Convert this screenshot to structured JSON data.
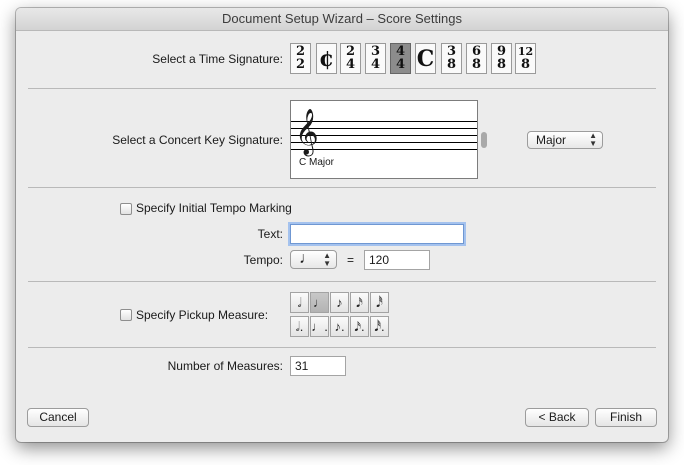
{
  "window": {
    "title": "Document Setup Wizard – Score Settings"
  },
  "time_signature": {
    "label": "Select a Time Signature:",
    "options": [
      {
        "top": "2",
        "bottom": "2"
      },
      {
        "symbol": "¢"
      },
      {
        "top": "2",
        "bottom": "4"
      },
      {
        "top": "3",
        "bottom": "4"
      },
      {
        "top": "4",
        "bottom": "4"
      },
      {
        "symbol": "C"
      },
      {
        "top": "3",
        "bottom": "8"
      },
      {
        "top": "6",
        "bottom": "8"
      },
      {
        "top": "9",
        "bottom": "8"
      },
      {
        "top": "12",
        "bottom": "8"
      }
    ]
  },
  "key_signature": {
    "label": "Select a Concert Key Signature:",
    "key_name": "C Major",
    "clef": "𝄞",
    "mode": "Major"
  },
  "tempo": {
    "checkbox_label": "Specify Initial Tempo Marking",
    "text_label": "Text:",
    "text_value": "",
    "tempo_label": "Tempo:",
    "note_symbol": "♩",
    "equals": "=",
    "value": "120"
  },
  "pickup": {
    "checkbox_label": "Specify Pickup Measure:",
    "notes_row1": [
      "𝅗𝅥",
      "♩",
      "♪",
      "𝅘𝅥𝅯",
      "𝅘𝅥𝅰"
    ],
    "notes_row2": [
      "𝅗𝅥.",
      "♩.",
      "♪.",
      "𝅘𝅥𝅯.",
      "𝅘𝅥𝅰."
    ]
  },
  "measures": {
    "label": "Number of Measures:",
    "value": "31"
  },
  "buttons": {
    "cancel": "Cancel",
    "back": "< Back",
    "finish": "Finish"
  }
}
